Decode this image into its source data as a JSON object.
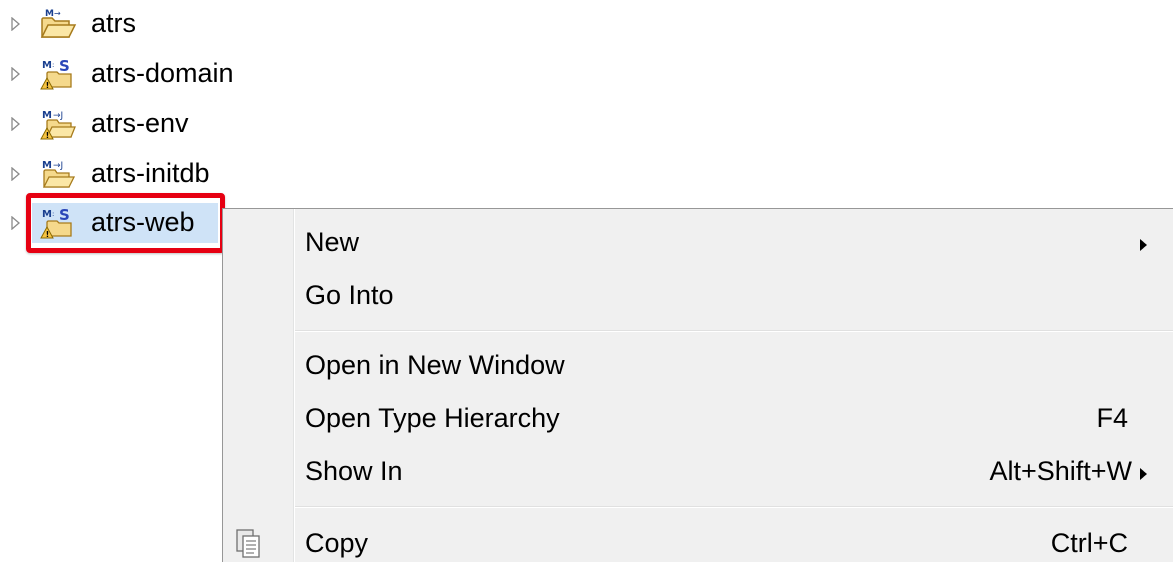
{
  "explorer": {
    "items": [
      {
        "label": "atrs",
        "icon": "maven-folder-icon",
        "selected": false
      },
      {
        "label": "atrs-domain",
        "icon": "maven-spring-project-warning-icon",
        "selected": false
      },
      {
        "label": "atrs-env",
        "icon": "maven-project-warning-icon",
        "selected": false
      },
      {
        "label": "atrs-initdb",
        "icon": "maven-project-icon",
        "selected": false
      },
      {
        "label": "atrs-web",
        "icon": "maven-spring-project-warning-icon",
        "selected": true
      }
    ],
    "highlight_color": "#e60012",
    "selection_color": "#cfe3f7"
  },
  "context_menu": {
    "items": [
      {
        "label": "New",
        "shortcut": "",
        "submenu": true
      },
      {
        "label": "Go Into",
        "shortcut": "",
        "submenu": false
      },
      {
        "label": "Open in New Window",
        "shortcut": "",
        "submenu": false
      },
      {
        "label": "Open Type Hierarchy",
        "shortcut": "F4",
        "submenu": false
      },
      {
        "label": "Show In",
        "shortcut": "Alt+Shift+W",
        "submenu": true
      },
      {
        "label": "Copy",
        "shortcut": "Ctrl+C",
        "submenu": false,
        "icon": "copy-icon"
      }
    ],
    "background": "#f0f0f0"
  }
}
